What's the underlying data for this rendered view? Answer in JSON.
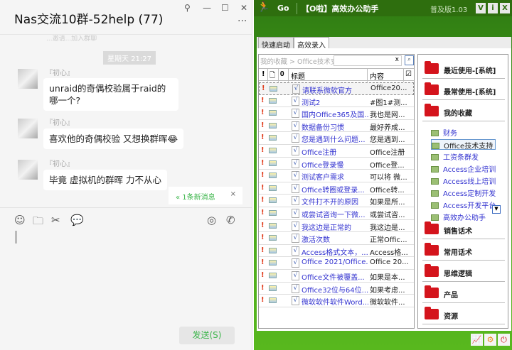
{
  "chat": {
    "title": "Nas交流10群-52help (77)",
    "faded_notice": "...邀请...加入群聊",
    "timestamp": "星期天 21:27",
    "messages": [
      {
        "sender": "『初心』",
        "text": "unraid的奇偶校验属于raid的哪一个?"
      },
      {
        "sender": "『初心』",
        "text": "喜欢他的奇偶校验  又想换群晖😂"
      },
      {
        "sender": "『初心』",
        "text": "毕竟 虚拟机的群晖 力不从心"
      }
    ],
    "new_message": "1条新消息",
    "send_label": "发送(S)"
  },
  "app": {
    "go_label": "Go",
    "title": "【O啦】高效办公助手",
    "version": "普及版1.03",
    "buttons": [
      "V",
      "i",
      "X"
    ],
    "tabs": [
      "快速启动",
      "高效录入"
    ],
    "breadcrumb": "我的收藏 > Office技术支持",
    "search_clear": "x",
    "columns": [
      "!",
      "",
      "",
      "标题",
      "内容"
    ],
    "rows": [
      {
        "title": "请联系微软官方",
        "content": "Office20..."
      },
      {
        "title": "测试2",
        "content": "#图1#测..."
      },
      {
        "title": "国内Office365及国...",
        "content": "我也是网..."
      },
      {
        "title": "数据备份习惯",
        "content": "最好养成..."
      },
      {
        "title": "您是遇到什么问题...",
        "content": "您是遇到..."
      },
      {
        "title": "Office注册",
        "content": "Office注册"
      },
      {
        "title": "Office登录慢",
        "content": "Office登..."
      },
      {
        "title": "测试客户需求",
        "content": "可以将 微..."
      },
      {
        "title": "Office转圈或登录...",
        "content": "Office转..."
      },
      {
        "title": "文件打不开的原因",
        "content": "如果是所..."
      },
      {
        "title": "或尝试咨询一下微...",
        "content": "或尝试咨..."
      },
      {
        "title": "我这边是正常的",
        "content": "我这边是..."
      },
      {
        "title": "激活次数",
        "content": "正常Offic..."
      },
      {
        "title": "Access格式文本，...",
        "content": "Access格..."
      },
      {
        "title": "Office 2021/Office...",
        "content": "Office 20..."
      },
      {
        "title": "Office文件被覆盖...",
        "content": "如果是本..."
      },
      {
        "title": "Office32位与64位...",
        "content": "如果考虑..."
      },
      {
        "title": "微软软件软件Word...",
        "content": "微软软件..."
      }
    ],
    "categories_top": [
      "最近使用-[系统]",
      "最常使用-[系统]",
      "我的收藏"
    ],
    "favorites": [
      "财务",
      "Office技术支持",
      "工资条群发",
      "Access企业培训",
      "Access线上培训",
      "Access定制开发",
      "Access开发平台",
      "高效办公助手"
    ],
    "categories_bottom": [
      "销售话术",
      "常用话术",
      "思维逻辑",
      "产品",
      "资源"
    ]
  }
}
